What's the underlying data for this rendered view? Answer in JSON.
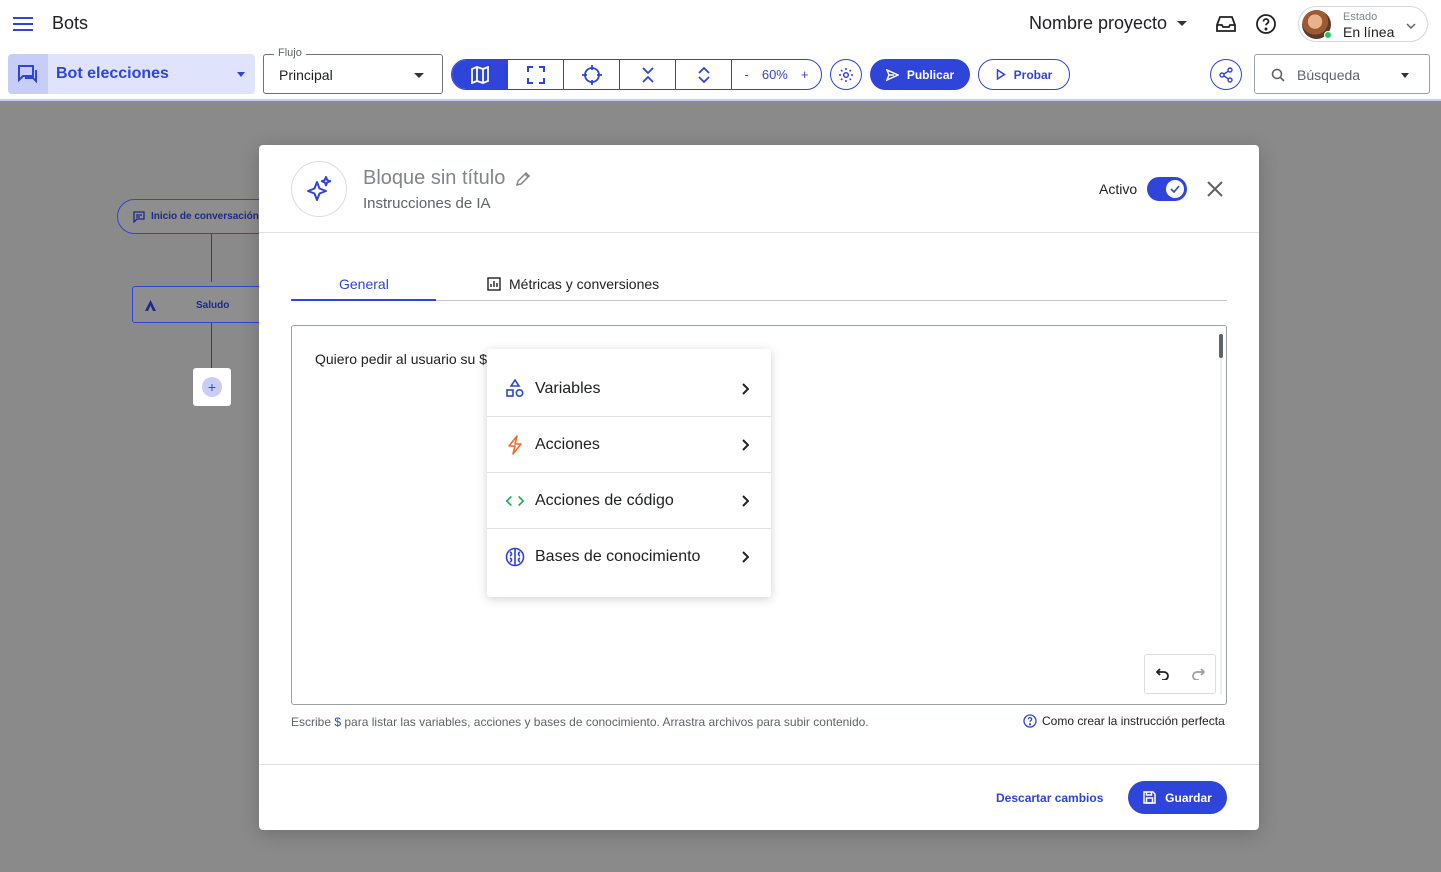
{
  "header": {
    "app_title": "Bots",
    "project_name": "Nombre proyecto",
    "status_label": "Estado",
    "status_value": "En línea",
    "status_color": "#22c55e"
  },
  "toolbar": {
    "bot_name": "Bot elecciones",
    "flow_label": "Flujo",
    "flow_value": "Principal",
    "zoom_minus": "-",
    "zoom_level": "60%",
    "zoom_plus": "+",
    "publish_label": "Publicar",
    "test_label": "Probar",
    "search_placeholder": "Búsqueda"
  },
  "canvas": {
    "start_node": "Inicio de conversación p",
    "greeting_node": "Saludo",
    "add_symbol": "+"
  },
  "modal": {
    "title": "Bloque sin título",
    "subtitle": "Instrucciones de IA",
    "active_label": "Activo",
    "tabs": [
      {
        "label": "General"
      },
      {
        "label": "Métricas y conversiones"
      }
    ],
    "editor_text": "Quiero pedir al usuario su $",
    "menu_items": [
      {
        "label": "Variables",
        "icon": "shapes-icon",
        "color": "#2f44d8"
      },
      {
        "label": "Acciones",
        "icon": "lightning-icon",
        "color": "#f26b2a"
      },
      {
        "label": "Acciones de código",
        "icon": "code-icon",
        "color": "#22a85a"
      },
      {
        "label": "Bases de conocimiento",
        "icon": "brain-icon",
        "color": "#2f44d8"
      }
    ],
    "hint_before": "Escribe ",
    "hint_dollar": "$",
    "hint_after": " para listar las variables, acciones y bases de conocimiento. Arrastra archivos para subir contenido.",
    "help_link": "Como crear la instrucción perfecta",
    "discard_label": "Descartar cambios",
    "save_label": "Guardar"
  },
  "colors": {
    "accent": "#2f44d8",
    "overlay": "#8a8a8a"
  }
}
